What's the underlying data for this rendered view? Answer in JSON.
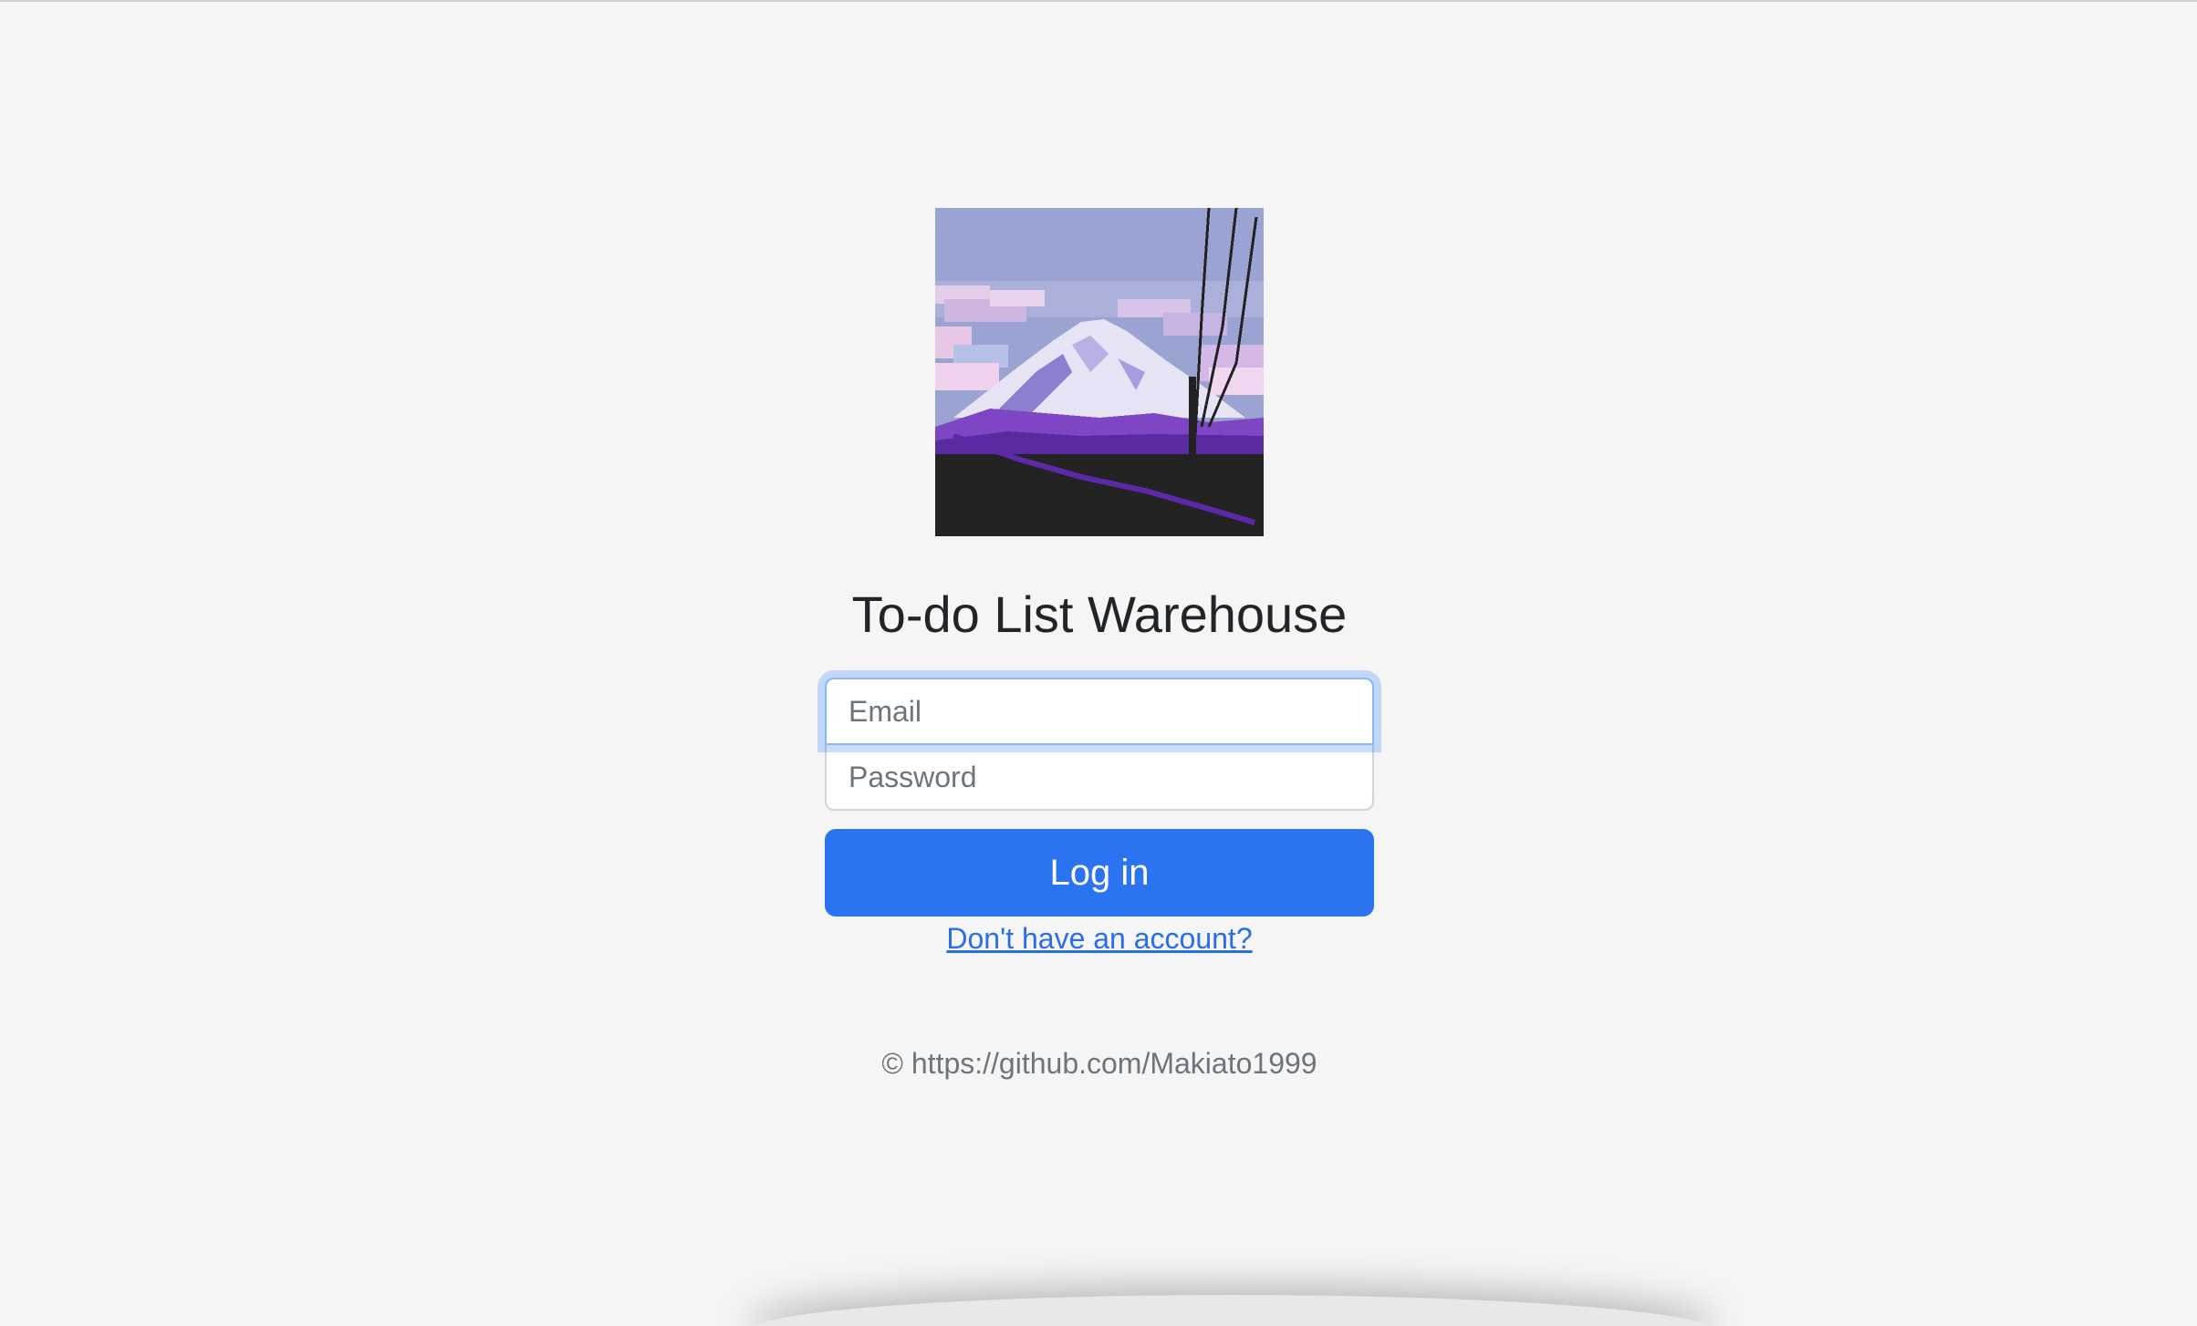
{
  "app": {
    "title": "To-do List Warehouse"
  },
  "logo": {
    "description_icon": "mountain-pixel-art-icon"
  },
  "form": {
    "email_placeholder": "Email",
    "email_value": "",
    "password_placeholder": "Password",
    "password_value": "",
    "login_label": "Log in",
    "signup_link_label": "Don't have an account?"
  },
  "footer": {
    "copyright": "© https://github.com/Makiato1999"
  },
  "colors": {
    "background": "#f5f5f5",
    "primary": "#2b73f1",
    "link": "#2b6de8",
    "text": "#212529",
    "muted": "#6c757d"
  }
}
